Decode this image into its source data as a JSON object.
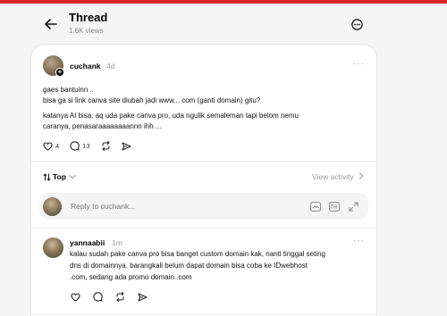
{
  "header": {
    "title": "Thread",
    "views": "1.6K views"
  },
  "post": {
    "username": "cuchank",
    "time": "4d",
    "lines": [
      "gaes bantuinn ..",
      "bisa ga si link canva site diubah jadi www... com (ganti domain) gitu?",
      "katanya AI bisa. aq uda pake canva pro, uda ngulik semaleman tapi belom nemu",
      "caranya, penasaraaaaaaaannn ihh ..."
    ],
    "likes": "4",
    "comments": "13"
  },
  "sort": {
    "label": "Top",
    "view_activity": "View activity"
  },
  "reply": {
    "placeholder": "Reply to cuchank..."
  },
  "comment": {
    "username": "yannaabii",
    "time": "1m",
    "lines": [
      "kalau sudah pake canva pro bisa banget custom domain kak, nanti tinggal seting",
      "dns di domainnya. barangkali belum dapat domain bisa coba ke IDwebhost",
      ".com, sedang ada promo domain .com"
    ]
  },
  "colors": {
    "accent_bar": "#d7272e",
    "background": "#f5f5f5",
    "muted_text": "#999999"
  },
  "icons": [
    "back-arrow-icon",
    "more-options-icon",
    "heart-icon",
    "comment-icon",
    "repost-icon",
    "share-icon",
    "sort-icon",
    "chevron-down-icon",
    "chevron-right-icon",
    "gif-icon",
    "image-icon",
    "expand-icon"
  ]
}
